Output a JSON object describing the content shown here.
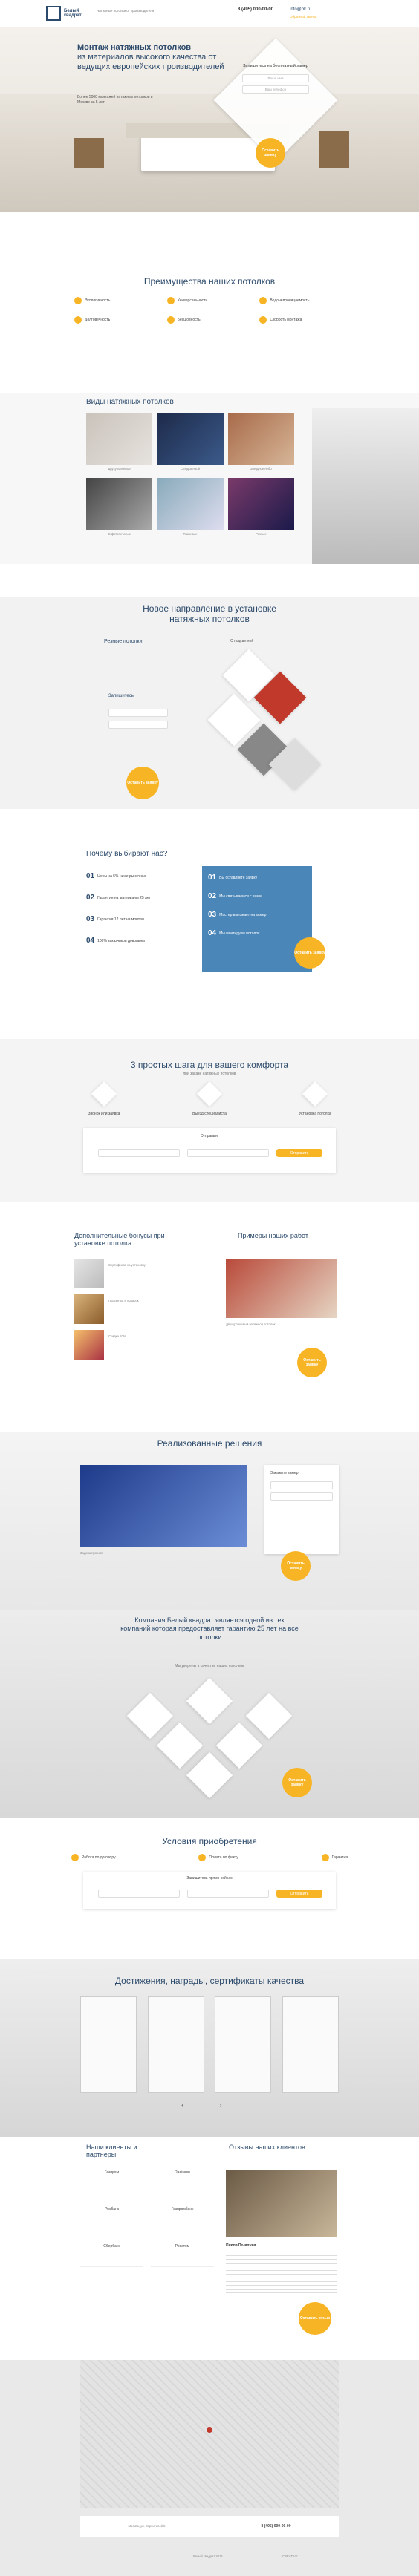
{
  "header": {
    "logo": "Белый квадрат",
    "tagline": "Натяжные потолки от производителя",
    "phone": "8 (495) 000-00-00",
    "email": "info@bk.ru",
    "callback": "Обратный звонок"
  },
  "hero": {
    "title_bold": "Монтаж натяжных потолков",
    "title_rest": "из материалов высокого качества от ведущих европейских производителей",
    "lead": "Более 5000 монтажей натяжных потолков в Москве за 5 лет",
    "form_title": "Запишитесь на бесплатный замер",
    "name_ph": "Ваше имя",
    "phone_ph": "Ваш телефон",
    "cta": "Оставить заявку"
  },
  "advantages": {
    "title": "Преимущества наших потолков",
    "items": [
      "Экологичность",
      "Универсальность",
      "Водонепроницаемость",
      "Долговечность",
      "Бесшовность",
      "Скорость монтажа"
    ]
  },
  "types": {
    "title": "Виды натяжных потолков",
    "items": [
      "Двухуровневые",
      "С подсветкой",
      "Звездное небо",
      "С фотопечатью",
      "Тканевые",
      "Резные"
    ]
  },
  "newdir": {
    "title": "Новое направление в установке натяжных потолков",
    "tag": "Резные потолки",
    "with": "С подсветкой",
    "form_title": "Запишитесь",
    "cta": "Оставить заявку"
  },
  "why": {
    "title": "Почему выбирают нас?",
    "left": [
      {
        "n": "01",
        "t": "Цены на 5% ниже рыночных"
      },
      {
        "n": "02",
        "t": "Гарантия на материалы 25 лет"
      },
      {
        "n": "03",
        "t": "Гарантия 12 лет на монтаж"
      },
      {
        "n": "04",
        "t": "100% заказчиков довольны"
      }
    ],
    "right": [
      {
        "n": "01",
        "t": "Вы оставляете заявку"
      },
      {
        "n": "02",
        "t": "Мы связываемся с вами"
      },
      {
        "n": "03",
        "t": "Мастер выезжает на замер"
      },
      {
        "n": "04",
        "t": "Мы монтируем потолок"
      }
    ],
    "cta": "Оставить заявку"
  },
  "steps": {
    "title": "3 простых шага для вашего комфорта",
    "subtitle": "при заказе натяжных потолков",
    "items": [
      "Звонок или заявка",
      "Выезд специалиста",
      "Установка потолка"
    ],
    "form_title": "Отправьте",
    "cta": "Отправить"
  },
  "bonus": {
    "title": "Дополнительные бонусы при установке потолка",
    "items": [
      "Сертификат на установку",
      "Подсветка в подарок",
      "Скидка 10%"
    ]
  },
  "examples": {
    "title": "Примеры наших работ",
    "caption": "Двухуровневый натяжной потолок",
    "cta": "Оставить заявку"
  },
  "solutions": {
    "title": "Реализованные решения",
    "caption": "Задача проекта",
    "form_title": "Закажите замер",
    "cta": "Оставить заявку"
  },
  "guarantee": {
    "title": "Компания Белый квадрат является одной из тех компаний которая предоставляет гарантию 25 лет на все потолки",
    "sub": "Мы уверены в качестве наших потолков",
    "cta": "Оставить заявку"
  },
  "terms": {
    "title": "Условия приобретения",
    "items": [
      "Работа по договору",
      "Оплата по факту",
      "Гарантия"
    ],
    "form_title": "Запишитесь прямо сейчас",
    "cta": "Отправить"
  },
  "awards": {
    "title": "Достижения, награды, сертификаты качества"
  },
  "clients": {
    "title": "Наши клиенты и партнеры",
    "logos": [
      "Газпром",
      "Radisson",
      "Росбанк",
      "Газпромбанк",
      "Сбербанк",
      "Росатом"
    ]
  },
  "reviews": {
    "title": "Отзывы наших клиентов",
    "name": "Ирина Пузанова",
    "cta": "Оставить отзыв"
  },
  "footer": {
    "address": "Москва, ул. Строителей 5",
    "phone": "8 (495) 000-00-00",
    "copyright": "Белый квадрат 2016",
    "dev": "CREATIVE"
  }
}
